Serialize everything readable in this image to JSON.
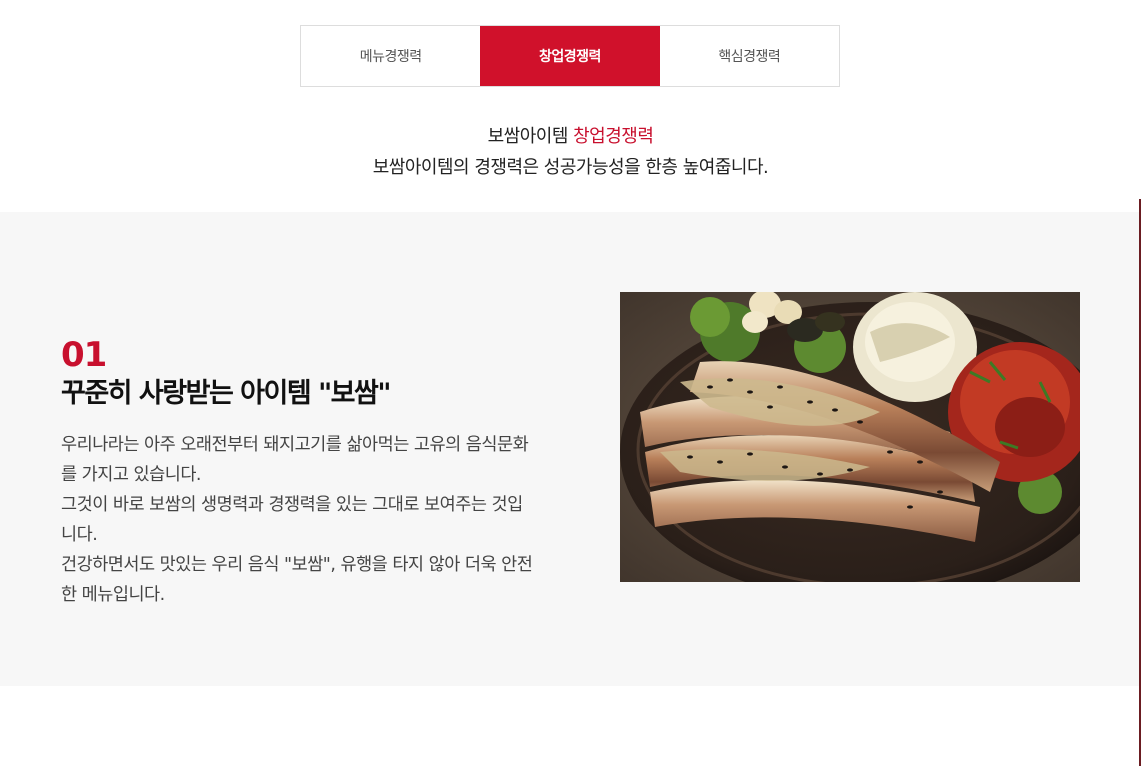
{
  "tabs": [
    {
      "label": "메뉴경쟁력",
      "active": false
    },
    {
      "label": "창업경쟁력",
      "active": true
    },
    {
      "label": "핵심경쟁력",
      "active": false
    }
  ],
  "intro": {
    "title_prefix": "보쌈아이템 ",
    "title_accent": "창업경쟁력",
    "subtitle": "보쌈아이템의 경쟁력은 성공가능성을 한층 높여줍니다."
  },
  "feature": {
    "number": "01",
    "title": "꾸준히 사랑받는 아이템 \"보쌈\"",
    "body_lines": [
      "우리나라는 아주 오래전부터 돼지고기를 삶아먹는 고유의 음식문화",
      "를 가지고 있습니다.",
      "그것이 바로 보쌈의 생명력과 경쟁력을 있는 그대로 보여주는 것입",
      "니다.",
      "건강하면서도 맛있는 우리 음식 \"보쌈\", 유행을 타지 않아 더욱 안전",
      "한 메뉴입니다."
    ]
  },
  "colors": {
    "accent": "#c8102e",
    "tab_active_bg": "#d0112b",
    "section_bg": "#f7f7f7"
  }
}
